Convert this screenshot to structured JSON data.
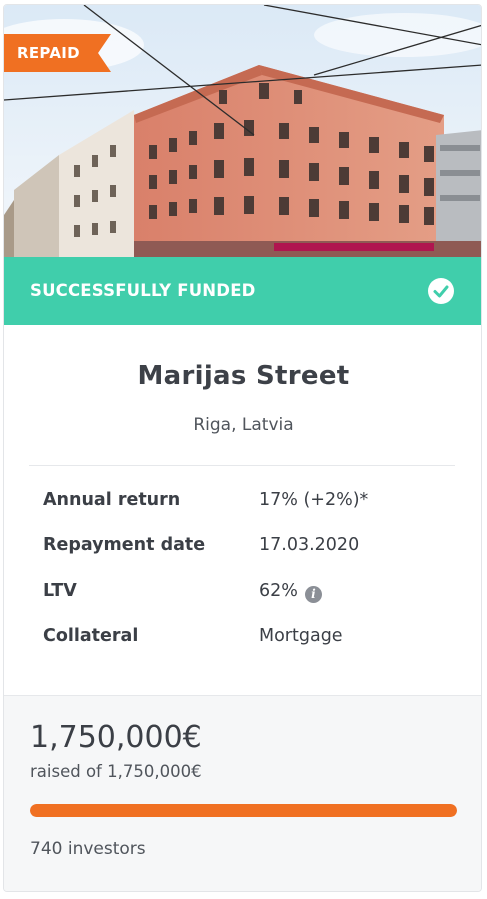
{
  "badge": {
    "label": "REPAID",
    "color": "#f07022"
  },
  "banner": {
    "label": "SUCCESSFULLY FUNDED",
    "color": "#40ceab",
    "icon": "check-circle-icon"
  },
  "project": {
    "title": "Marijas Street",
    "location": "Riga, Latvia"
  },
  "details": [
    {
      "key": "Annual return",
      "value": "17% (+2%)*"
    },
    {
      "key": "Repayment date",
      "value": "17.03.2020"
    },
    {
      "key": "LTV",
      "value": "62%",
      "icon": "info-icon"
    },
    {
      "key": "Collateral",
      "value": "Mortgage"
    }
  ],
  "funding": {
    "raised": "1,750,000€",
    "raised_of": "raised of 1,750,000€",
    "progress_fraction": 1.0,
    "progress_color": "#f07022",
    "investors": "740 investors"
  }
}
